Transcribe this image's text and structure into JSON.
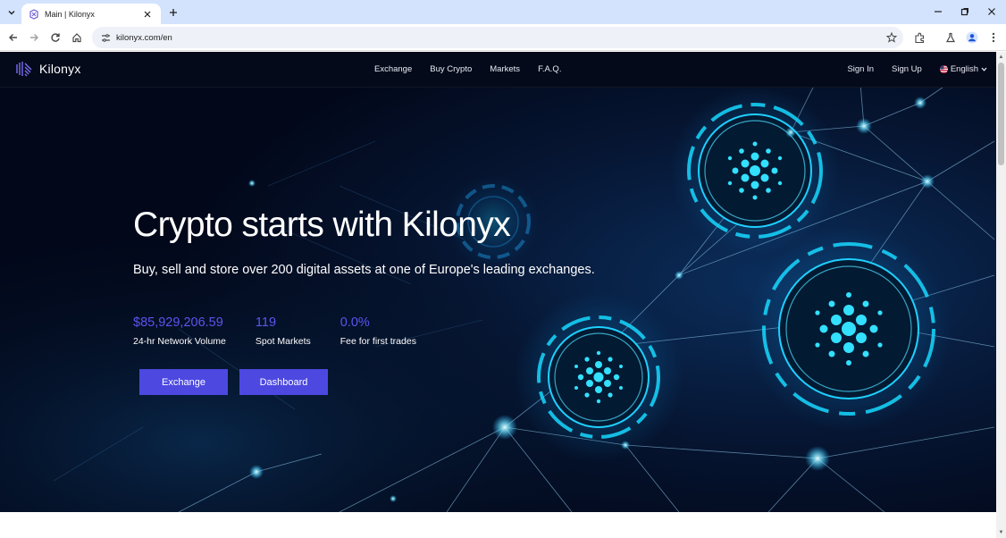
{
  "browser": {
    "tab_title": "Main | Kilonyx",
    "url": "kilonyx.com/en",
    "icons": [
      "tab-list-icon",
      "close-icon",
      "plus-icon",
      "minimize-icon",
      "restore-icon",
      "close-window-icon",
      "back-icon",
      "forward-icon",
      "reload-icon",
      "home-icon",
      "site-info-icon",
      "star-icon",
      "extensions-icon",
      "labs-icon",
      "profile-icon",
      "menu-icon"
    ]
  },
  "site": {
    "brand": "Kilonyx",
    "nav": {
      "links": [
        "Exchange",
        "Buy Crypto",
        "Markets",
        "F.A.Q."
      ],
      "sign_in": "Sign In",
      "sign_up": "Sign Up",
      "language": "English"
    },
    "hero": {
      "headline": "Crypto starts with Kilonyx",
      "subheadline": "Buy, sell and store over 200 digital assets at one of Europe's leading exchanges.",
      "stats": [
        {
          "value": "$85,929,206.59",
          "label": "24-hr Network Volume"
        },
        {
          "value": "119",
          "label": "Spot Markets"
        },
        {
          "value": "0.0%",
          "label": "Fee for first trades"
        }
      ],
      "buttons": {
        "exchange": "Exchange",
        "dashboard": "Dashboard"
      }
    },
    "colors": {
      "accent": "#4c48e0",
      "stat_value": "#5b55f0",
      "nav_bg": "#050a1a",
      "hero_bg": "#030a1c",
      "glow": "#18d8ff"
    }
  }
}
